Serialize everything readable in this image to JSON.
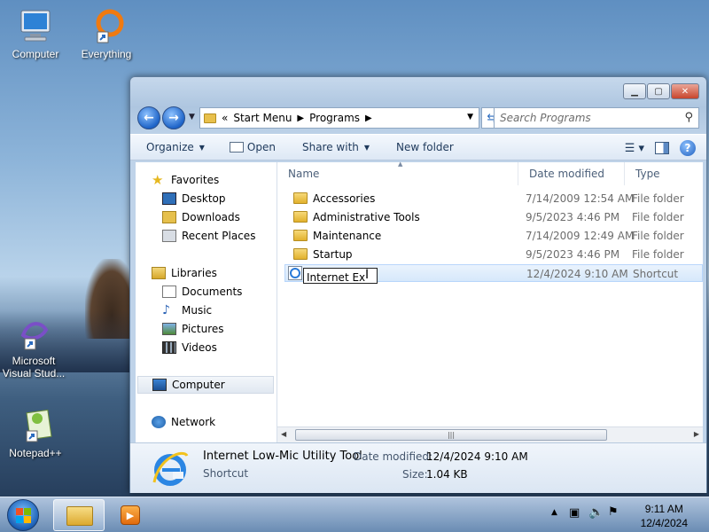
{
  "desktop": {
    "icons": [
      {
        "label": "Computer"
      },
      {
        "label": "Everything"
      },
      {
        "label": "Microsoft Visual Stud..."
      },
      {
        "label": "Notepad++"
      }
    ]
  },
  "window": {
    "address": {
      "overflow": "«",
      "crumbs": [
        "Start Menu",
        "Programs"
      ]
    },
    "search": {
      "placeholder": "Search Programs"
    },
    "toolbar": {
      "organize": "Organize",
      "open": "Open",
      "share_with": "Share with",
      "new_folder": "New folder"
    },
    "nav_pane": {
      "favorites": "Favorites",
      "favorites_items": [
        "Desktop",
        "Downloads",
        "Recent Places"
      ],
      "libraries": "Libraries",
      "libraries_items": [
        "Documents",
        "Music",
        "Pictures",
        "Videos"
      ],
      "computer": "Computer",
      "network": "Network"
    },
    "columns": {
      "name": "Name",
      "date_modified": "Date modified",
      "type": "Type"
    },
    "files": [
      {
        "name": "Accessories",
        "date": "7/14/2009 12:54 AM",
        "type": "File folder"
      },
      {
        "name": "Administrative Tools",
        "date": "9/5/2023 4:46 PM",
        "type": "File folder"
      },
      {
        "name": "Maintenance",
        "date": "7/14/2009 12:49 AM",
        "type": "File folder"
      },
      {
        "name": "Startup",
        "date": "9/5/2023 4:46 PM",
        "type": "File folder"
      },
      {
        "name": "Internet Ex",
        "date": "12/4/2024 9:10 AM",
        "type": "Shortcut"
      }
    ],
    "details": {
      "name": "Internet Low-Mic Utility Tool",
      "kind": "Shortcut",
      "date_label": "Date modified:",
      "date_value": "12/4/2024 9:10 AM",
      "size_label": "Size:",
      "size_value": "1.04 KB"
    }
  },
  "taskbar": {
    "time": "9:11 AM",
    "date": "12/4/2024"
  },
  "colors": {
    "accent": "#1e64c8",
    "selection": "#d6e8fb",
    "folder": "#e2b12c"
  }
}
